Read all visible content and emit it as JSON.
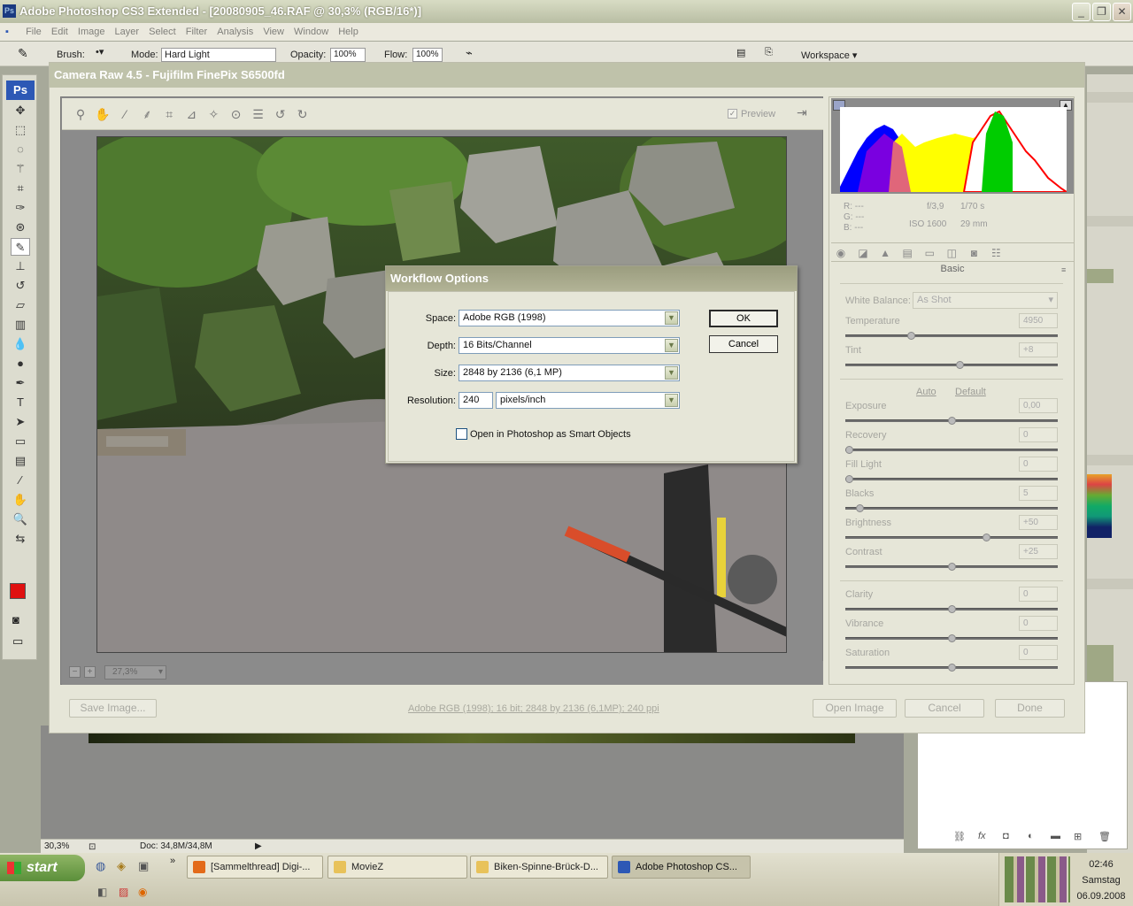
{
  "app": {
    "title": "Adobe Photoshop CS3 Extended - [20080905_46.RAF @ 30,3% (RGB/16*)]",
    "ps_icon": "Ps"
  },
  "menu": [
    "File",
    "Edit",
    "Image",
    "Layer",
    "Select",
    "Filter",
    "Analysis",
    "View",
    "Window",
    "Help"
  ],
  "options": {
    "brush_label": "Brush:",
    "mode_label": "Mode:",
    "mode_value": "Hard Light",
    "opacity_label": "Opacity:",
    "opacity_value": "100%",
    "flow_label": "Flow:",
    "flow_value": "100%",
    "workspace_label": "Workspace"
  },
  "toolbox": {
    "logo": "Ps"
  },
  "camera_raw": {
    "title": "Camera Raw 4.5  -  Fujifilm FinePix S6500fd",
    "preview_label": "Preview",
    "zoom_value": "27,3%",
    "rgb": {
      "r_label": "R:",
      "g_label": "G:",
      "b_label": "B:",
      "r": "---",
      "g": "---",
      "b": "---"
    },
    "exif": {
      "aperture": "f/3,9",
      "shutter": "1/70 s",
      "iso": "ISO 1600",
      "focal": "29 mm"
    },
    "panel_title": "Basic",
    "white_balance_label": "White Balance:",
    "white_balance_value": "As Shot",
    "auto_link": "Auto",
    "default_link": "Default",
    "sliders": [
      {
        "label": "Temperature",
        "value": "4950",
        "fraction": 0.3
      },
      {
        "label": "Tint",
        "value": "+8",
        "fraction": 0.54
      },
      {
        "label": "Exposure",
        "value": "0,00",
        "fraction": 0.5
      },
      {
        "label": "Recovery",
        "value": "0",
        "fraction": 0.0
      },
      {
        "label": "Fill Light",
        "value": "0",
        "fraction": 0.0
      },
      {
        "label": "Blacks",
        "value": "5",
        "fraction": 0.05
      },
      {
        "label": "Brightness",
        "value": "+50",
        "fraction": 0.67
      },
      {
        "label": "Contrast",
        "value": "+25",
        "fraction": 0.5
      },
      {
        "label": "Clarity",
        "value": "0",
        "fraction": 0.5
      },
      {
        "label": "Vibrance",
        "value": "0",
        "fraction": 0.5
      },
      {
        "label": "Saturation",
        "value": "0",
        "fraction": 0.5
      }
    ],
    "save_button": "Save Image...",
    "workflow_link": "Adobe RGB (1998); 16 bit; 2848 by 2136 (6,1MP); 240 ppi",
    "open_button": "Open Image",
    "cancel_button": "Cancel",
    "done_button": "Done"
  },
  "workflow": {
    "title": "Workflow Options",
    "space_label": "Space:",
    "space_value": "Adobe RGB (1998)",
    "depth_label": "Depth:",
    "depth_value": "16 Bits/Channel",
    "size_label": "Size:",
    "size_value": "2848 by 2136  (6,1 MP)",
    "resolution_label": "Resolution:",
    "resolution_value": "240",
    "resolution_unit": "pixels/inch",
    "smart_objects_label": "Open in Photoshop as Smart Objects",
    "smart_objects_checked": false,
    "ok_button": "OK",
    "cancel_button": "Cancel"
  },
  "status": {
    "zoom": "30,3%",
    "doc": "Doc: 34,8M/34,8M"
  },
  "taskbar": {
    "start": "start",
    "tasks": [
      "[Sammelthread] Digi-...",
      "MovieZ",
      "Biken-Spinne-Brück-D...",
      "Adobe Photoshop CS..."
    ],
    "active_task": 3,
    "time": "02:46",
    "day": "Samstag",
    "date": "06.09.2008"
  },
  "colors": {
    "accent_red": "#e01010",
    "ps_blue": "#2d58b5",
    "title_green": "#bfc2aa",
    "start_green": "#5b8f3a"
  }
}
